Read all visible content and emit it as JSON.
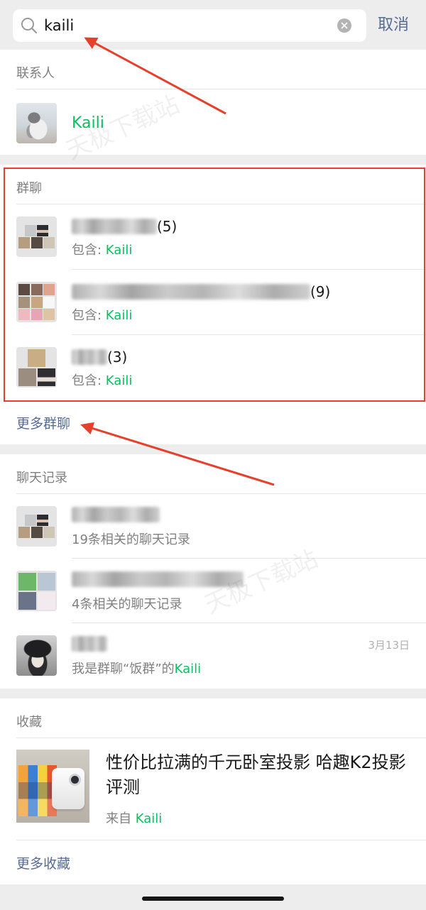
{
  "search": {
    "query": "kaili",
    "cancel_label": "取消",
    "icon": "search-icon",
    "clear_icon": "clear-icon"
  },
  "contacts": {
    "header": "联系人",
    "items": [
      {
        "name": "Kaili"
      }
    ]
  },
  "groups": {
    "header": "群聊",
    "items": [
      {
        "count": "(5)",
        "member_label": "包含: ",
        "member_match": "Kaili"
      },
      {
        "count": "(9)",
        "member_label": "包含: ",
        "member_match": "Kaili"
      },
      {
        "count": "(3)",
        "member_label": "包含: ",
        "member_match": "Kaili"
      }
    ],
    "more_label": "更多群聊"
  },
  "chat_history": {
    "header": "聊天记录",
    "items": [
      {
        "summary": "19条相关的聊天记录"
      },
      {
        "summary": "4条相关的聊天记录"
      },
      {
        "date": "3月13日",
        "message_prefix": "我是群聊“饭群”的",
        "message_match": "Kaili"
      }
    ]
  },
  "favorites": {
    "header": "收藏",
    "items": [
      {
        "title": "性价比拉满的千元卧室投影 哈趣K2投影评测",
        "source_prefix": "来自 ",
        "source": "Kaili"
      }
    ],
    "more_label": "更多收藏"
  },
  "watermark": "天极下载站",
  "colors": {
    "match_highlight": "#07c160",
    "link": "#576b95",
    "annotation": "#e6402c",
    "page_background": "#ededed"
  }
}
